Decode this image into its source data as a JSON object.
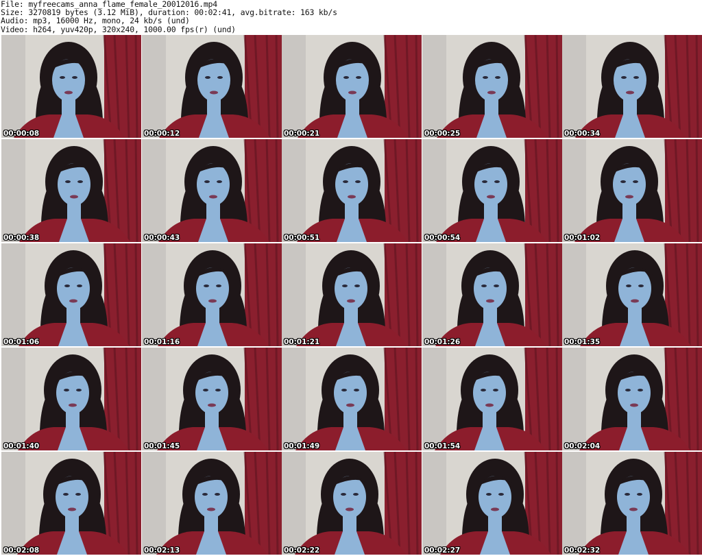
{
  "header": {
    "file_line": "File: myfreecams_anna_flame_female_20012016.mp4",
    "size_line": "Size: 3270819 bytes (3.12 MiB), duration: 00:02:41, avg.bitrate: 163 kb/s",
    "audio_line": "Audio: mp3, 16000 Hz, mono, 24 kb/s (und)",
    "video_line": "Video: h264, yuv420p, 320x240, 1000.00 fps(r) (und)"
  },
  "thumbnails": [
    {
      "timestamp": "00:00:08"
    },
    {
      "timestamp": "00:00:12"
    },
    {
      "timestamp": "00:00:21"
    },
    {
      "timestamp": "00:00:25"
    },
    {
      "timestamp": "00:00:34"
    },
    {
      "timestamp": "00:00:38"
    },
    {
      "timestamp": "00:00:43"
    },
    {
      "timestamp": "00:00:51"
    },
    {
      "timestamp": "00:00:54"
    },
    {
      "timestamp": "00:01:02"
    },
    {
      "timestamp": "00:01:06"
    },
    {
      "timestamp": "00:01:16"
    },
    {
      "timestamp": "00:01:21"
    },
    {
      "timestamp": "00:01:26"
    },
    {
      "timestamp": "00:01:35"
    },
    {
      "timestamp": "00:01:40"
    },
    {
      "timestamp": "00:01:45"
    },
    {
      "timestamp": "00:01:49"
    },
    {
      "timestamp": "00:01:54"
    },
    {
      "timestamp": "00:02:04"
    },
    {
      "timestamp": "00:02:08"
    },
    {
      "timestamp": "00:02:13"
    },
    {
      "timestamp": "00:02:22"
    },
    {
      "timestamp": "00:02:27"
    },
    {
      "timestamp": "00:02:32"
    }
  ],
  "colors": {
    "wall": "#d9d6d0",
    "curtain": "#8a1f2e",
    "hair": "#1e1618",
    "skin": "#8fb4d8",
    "top": "#8c1d2c"
  }
}
